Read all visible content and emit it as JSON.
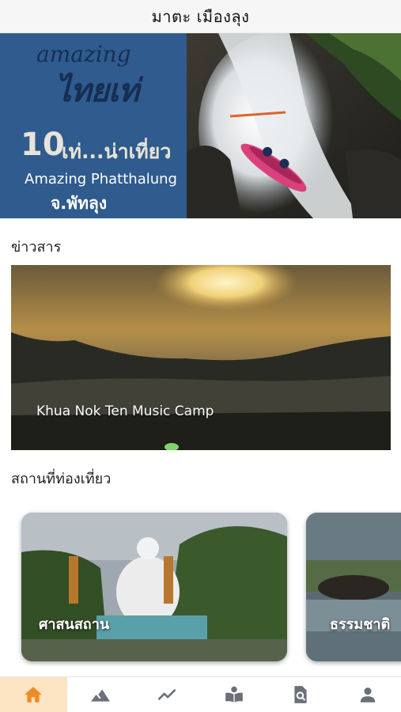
{
  "header": {
    "title": "มาตะ เมืองลุง"
  },
  "hero": {
    "brand_line1": "amazing",
    "brand_line2": "ไทยเท่",
    "number": "10",
    "headline": "เท่...น่าเที่ยว",
    "subtitle_en": "Amazing Phatthalung",
    "subtitle_th": "จ.พัทลุง"
  },
  "news": {
    "section_title": "ข่าวสาร",
    "card_caption": "Khua Nok Ten Music Camp"
  },
  "places": {
    "section_title": "สถานที่ท่องเที่ยว",
    "cards": [
      {
        "label": "ศาสนสถาน"
      },
      {
        "label": "ธรรมชาติ"
      }
    ]
  },
  "bottom_nav": {
    "items": [
      {
        "icon": "home-icon",
        "active": true
      },
      {
        "icon": "mountain-icon",
        "active": false
      },
      {
        "icon": "trending-icon",
        "active": false
      },
      {
        "icon": "book-reader-icon",
        "active": false
      },
      {
        "icon": "search-document-icon",
        "active": false
      },
      {
        "icon": "person-icon",
        "active": false
      }
    ],
    "active_color": "#f08a24",
    "inactive_color": "#6b6f78"
  }
}
